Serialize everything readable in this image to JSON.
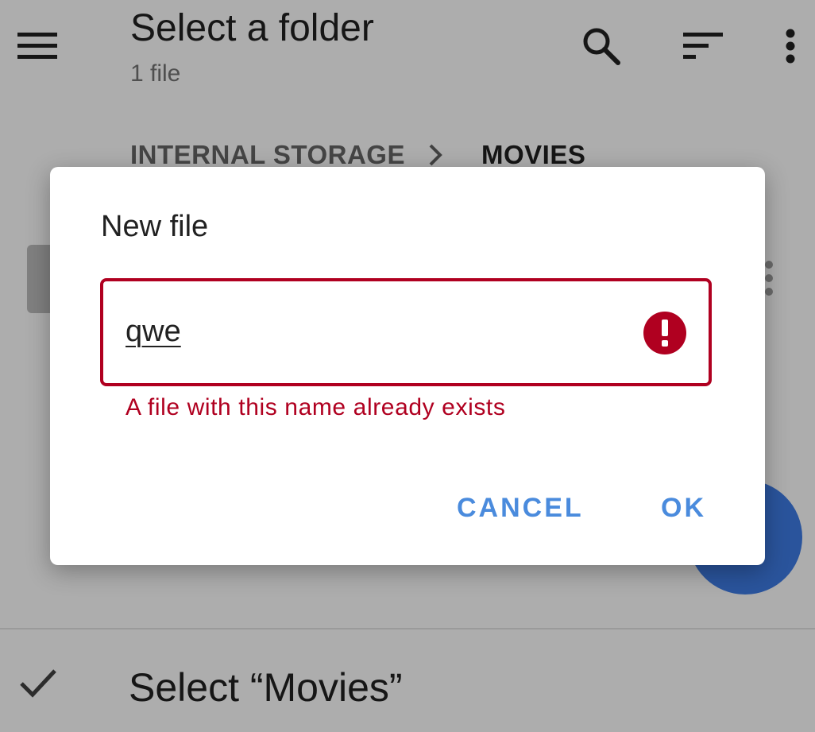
{
  "appbar": {
    "title": "Select a folder",
    "subtitle": "1 file",
    "icons": {
      "menu": "hamburger-menu-icon",
      "search": "search-icon",
      "sort": "sort-icon",
      "more": "more-vert-icon"
    }
  },
  "breadcrumb": {
    "items": [
      "INTERNAL STORAGE",
      "MOVIES"
    ],
    "separator_icon": "chevron-right-icon"
  },
  "bottom_bar": {
    "icon": "check-icon",
    "label": "Select “Movies”"
  },
  "dialog": {
    "title": "New file",
    "field_value": "qwe",
    "error_icon": "error-icon",
    "error_text": "A file with this name already exists",
    "cancel_label": "CANCEL",
    "ok_label": "OK"
  },
  "colors": {
    "error": "#b00020",
    "accent": "#4a8bdd",
    "fab": "#3f7de6"
  }
}
